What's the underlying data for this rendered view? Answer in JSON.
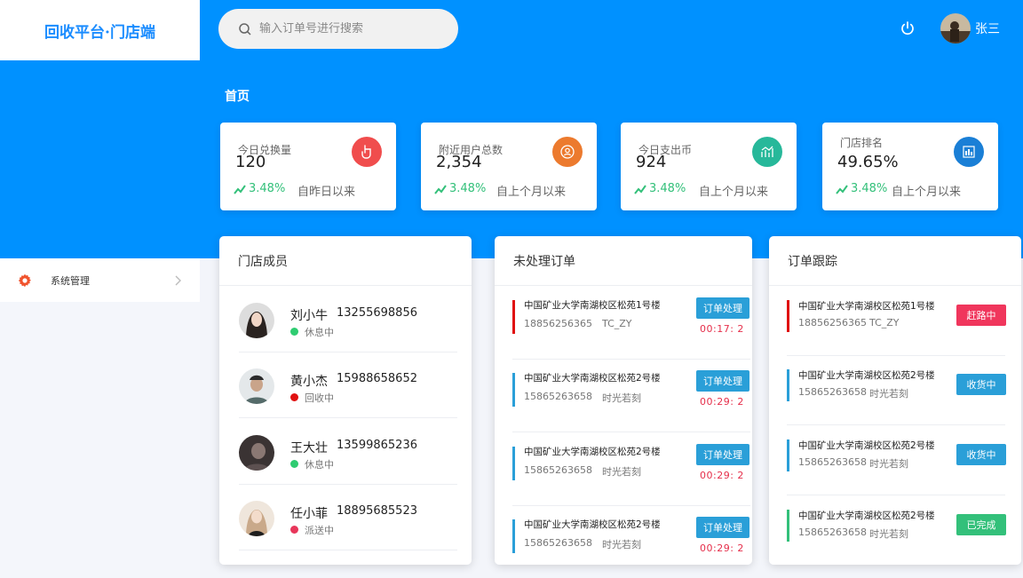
{
  "app": {
    "title": "回收平台·门店端"
  },
  "sidebar": {
    "items": [
      {
        "label": "系统管理",
        "icon": "gear-icon"
      }
    ]
  },
  "header": {
    "search_placeholder": "输入订单号进行搜索",
    "username": "张三"
  },
  "page_title": "首页",
  "stats": [
    {
      "label": "今日兑换量",
      "value": "120",
      "trend": "3.48%",
      "compare": "自昨日以来",
      "icon": "pointer-icon",
      "color": "#f04d4d"
    },
    {
      "label": "附近用户总数",
      "value": "2,354",
      "trend": "3.48%",
      "compare": "自上个月以来",
      "icon": "user-location-icon",
      "color": "#ec7a2e"
    },
    {
      "label": "今日支出币",
      "value": "924",
      "trend": "3.48%",
      "compare": "自上个月以来",
      "icon": "growth-chart-icon",
      "color": "#27b89a"
    },
    {
      "label": "门店排名",
      "value": "49.65%",
      "trend": "3.48%",
      "compare": "自上个月以来",
      "icon": "bar-chart-icon",
      "color": "#1a7fd6"
    }
  ],
  "members_panel": {
    "title": "门店成员",
    "members": [
      {
        "name": "刘小牛",
        "phone": "13255698856",
        "status": "休息中",
        "status_color": "#2ecc71"
      },
      {
        "name": "黄小杰",
        "phone": "15988658652",
        "status": "回收中",
        "status_color": "#e01010"
      },
      {
        "name": "王大壮",
        "phone": "13599865236",
        "status": "休息中",
        "status_color": "#2ecc71"
      },
      {
        "name": "任小菲",
        "phone": "18895685523",
        "status": "派送中",
        "status_color": "#e8365a"
      }
    ]
  },
  "orders_panel": {
    "title": "未处理订单",
    "orders": [
      {
        "address": "中国矿业大学南湖校区松苑1号楼",
        "phone": "18856256365",
        "user": "TC_ZY",
        "button": "订单处理",
        "timer": "00:17: 2",
        "bar_color": "#e01010"
      },
      {
        "address": "中国矿业大学南湖校区松苑2号楼",
        "phone": "15865263658",
        "user": "时光若刻",
        "button": "订单处理",
        "timer": "00:29: 2",
        "bar_color": "#2a9fd8"
      },
      {
        "address": "中国矿业大学南湖校区松苑2号楼",
        "phone": "15865263658",
        "user": "时光若刻",
        "button": "订单处理",
        "timer": "00:29: 2",
        "bar_color": "#2a9fd8"
      },
      {
        "address": "中国矿业大学南湖校区松苑2号楼",
        "phone": "15865263658",
        "user": "时光若刻",
        "button": "订单处理",
        "timer": "00:29: 2",
        "bar_color": "#2a9fd8"
      }
    ]
  },
  "tracking_panel": {
    "title": "订单跟踪",
    "items": [
      {
        "address": "中国矿业大学南湖校区松苑1号楼",
        "phone": "18856256365",
        "user": "TC_ZY",
        "status": "赶路中",
        "bar_color": "#e01010",
        "badge_color": "#f0365c"
      },
      {
        "address": "中国矿业大学南湖校区松苑2号楼",
        "phone": "15865263658",
        "user": "时光若刻",
        "status": "收货中",
        "bar_color": "#2a9fd8",
        "badge_color": "#2a9fd8"
      },
      {
        "address": "中国矿业大学南湖校区松苑2号楼",
        "phone": "15865263658",
        "user": "时光若刻",
        "status": "收货中",
        "bar_color": "#2a9fd8",
        "badge_color": "#2a9fd8"
      },
      {
        "address": "中国矿业大学南湖校区松苑2号楼",
        "phone": "15865263658",
        "user": "时光若刻",
        "status": "已完成",
        "bar_color": "#33c07a",
        "badge_color": "#33c07a"
      }
    ]
  }
}
